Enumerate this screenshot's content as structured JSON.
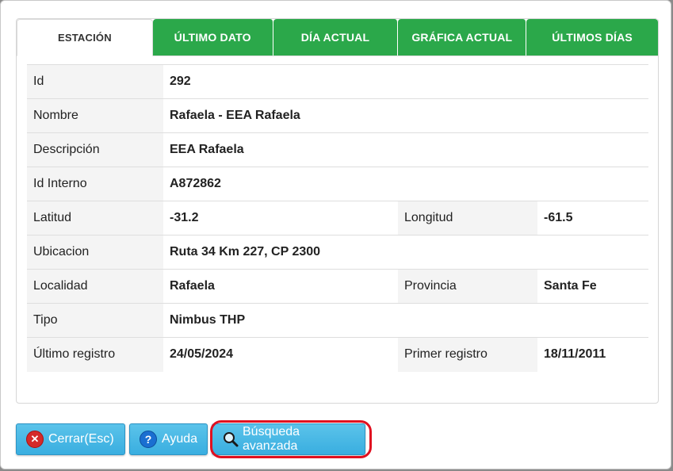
{
  "dialog": {
    "close_glyph": "×",
    "tabs": [
      {
        "label": "ESTACIÓN",
        "active": true
      },
      {
        "label": "ÚLTIMO DATO",
        "active": false
      },
      {
        "label": "DÍA ACTUAL",
        "active": false
      },
      {
        "label": "GRÁFICA ACTUAL",
        "active": false
      },
      {
        "label": "ÚLTIMOS DÍAS",
        "active": false
      }
    ],
    "rows": [
      {
        "label": "Id",
        "value": "292"
      },
      {
        "label": "Nombre",
        "value": "Rafaela - EEA Rafaela"
      },
      {
        "label": "Descripción",
        "value": "EEA Rafaela"
      },
      {
        "label": "Id Interno",
        "value": "A872862"
      },
      {
        "label": "Latitud",
        "value": "-31.2",
        "label2": "Longitud",
        "value2": "-61.5"
      },
      {
        "label": "Ubicacion",
        "value": "Ruta 34 Km 227, CP 2300"
      },
      {
        "label": "Localidad",
        "value": "Rafaela",
        "label2": "Provincia",
        "value2": "Santa Fe"
      },
      {
        "label": "Tipo",
        "value": "Nimbus THP"
      },
      {
        "label": "Último registro",
        "value": "24/05/2024",
        "label2": "Primer registro",
        "value2": "18/11/2011"
      }
    ],
    "buttons": {
      "cerrar": "Cerrar(Esc)",
      "ayuda": "Ayuda",
      "busqueda": "Búsqueda avanzada"
    },
    "icons": {
      "cerrar": "close-circle-icon",
      "ayuda": "help-circle-icon",
      "busqueda": "magnifier-icon"
    },
    "colors": {
      "tab_green": "#2ba84a",
      "button_blue": "#39aee0",
      "highlight_red": "#e01020"
    }
  }
}
